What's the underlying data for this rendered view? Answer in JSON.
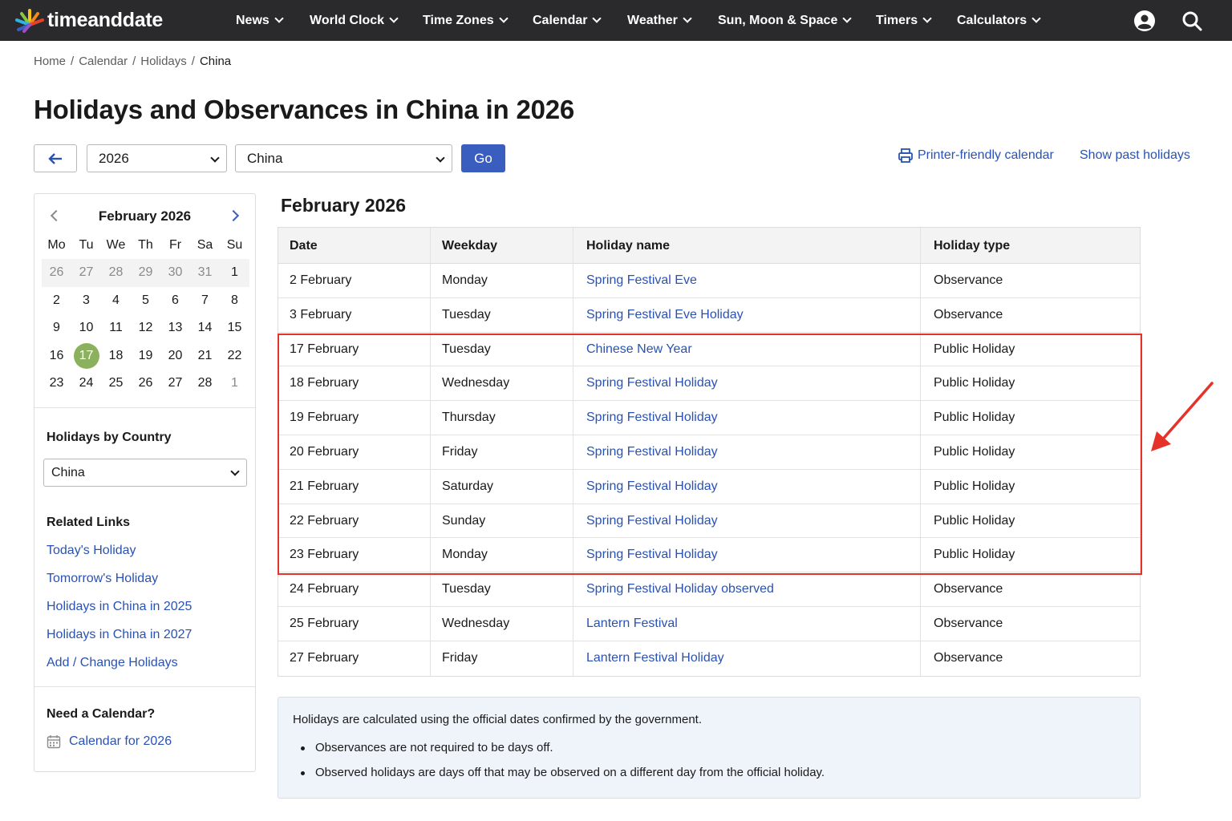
{
  "brand": {
    "name": "timeanddate"
  },
  "nav": {
    "items": [
      {
        "label": "News"
      },
      {
        "label": "World Clock"
      },
      {
        "label": "Time Zones"
      },
      {
        "label": "Calendar"
      },
      {
        "label": "Weather"
      },
      {
        "label": "Sun, Moon & Space"
      },
      {
        "label": "Timers"
      },
      {
        "label": "Calculators"
      }
    ],
    "icons": [
      "account-icon",
      "search-icon"
    ]
  },
  "breadcrumb": {
    "items": [
      "Home",
      "Calendar",
      "Holidays"
    ],
    "current": "China",
    "separator": "/"
  },
  "page_title": "Holidays and Observances in China in 2026",
  "controls": {
    "year": "2026",
    "country": "China",
    "go_label": "Go",
    "printer_link": "Printer-friendly calendar",
    "past_link": "Show past holidays"
  },
  "mini_calendar": {
    "title": "February 2026",
    "weekdays": [
      "Mo",
      "Tu",
      "We",
      "Th",
      "Fr",
      "Sa",
      "Su"
    ],
    "weeks": [
      [
        "26",
        "27",
        "28",
        "29",
        "30",
        "31",
        "1"
      ],
      [
        "2",
        "3",
        "4",
        "5",
        "6",
        "7",
        "8"
      ],
      [
        "9",
        "10",
        "11",
        "12",
        "13",
        "14",
        "15"
      ],
      [
        "16",
        "17",
        "18",
        "19",
        "20",
        "21",
        "22"
      ],
      [
        "23",
        "24",
        "25",
        "26",
        "27",
        "28",
        "1"
      ]
    ],
    "today": "17"
  },
  "sidebar": {
    "by_country_heading": "Holidays by Country",
    "country_select": "China",
    "related_heading": "Related Links",
    "related_links": [
      "Today's Holiday",
      "Tomorrow's Holiday",
      "Holidays in China in 2025",
      "Holidays in China in 2027",
      "Add / Change Holidays"
    ],
    "calendar_heading": "Need a Calendar?",
    "calendar_link": "Calendar for 2026"
  },
  "table": {
    "month_title": "February 2026",
    "headers": [
      "Date",
      "Weekday",
      "Holiday name",
      "Holiday type"
    ],
    "rows": [
      {
        "date": "2 February",
        "weekday": "Monday",
        "name": "Spring Festival Eve",
        "type": "Observance"
      },
      {
        "date": "3 February",
        "weekday": "Tuesday",
        "name": "Spring Festival Eve Holiday",
        "type": "Observance"
      },
      {
        "date": "17 February",
        "weekday": "Tuesday",
        "name": "Chinese New Year",
        "type": "Public Holiday"
      },
      {
        "date": "18 February",
        "weekday": "Wednesday",
        "name": "Spring Festival Holiday",
        "type": "Public Holiday"
      },
      {
        "date": "19 February",
        "weekday": "Thursday",
        "name": "Spring Festival Holiday",
        "type": "Public Holiday"
      },
      {
        "date": "20 February",
        "weekday": "Friday",
        "name": "Spring Festival Holiday",
        "type": "Public Holiday"
      },
      {
        "date": "21 February",
        "weekday": "Saturday",
        "name": "Spring Festival Holiday",
        "type": "Public Holiday"
      },
      {
        "date": "22 February",
        "weekday": "Sunday",
        "name": "Spring Festival Holiday",
        "type": "Public Holiday"
      },
      {
        "date": "23 February",
        "weekday": "Monday",
        "name": "Spring Festival Holiday",
        "type": "Public Holiday"
      },
      {
        "date": "24 February",
        "weekday": "Tuesday",
        "name": "Spring Festival Holiday observed",
        "type": "Observance"
      },
      {
        "date": "25 February",
        "weekday": "Wednesday",
        "name": "Lantern Festival",
        "type": "Observance"
      },
      {
        "date": "27 February",
        "weekday": "Friday",
        "name": "Lantern Festival Holiday",
        "type": "Observance"
      }
    ]
  },
  "note": {
    "text": "Holidays are calculated using the official dates confirmed by the government.",
    "bullets": [
      "Observances are not required to be days off.",
      "Observed holidays are days off that may be observed on a different day from the official holiday."
    ]
  },
  "colors": {
    "topbar": "#2a2a2c",
    "link": "#2952b3",
    "button": "#3a5dc0",
    "today_marker": "#8bb15e",
    "highlight": "#e5332a"
  }
}
